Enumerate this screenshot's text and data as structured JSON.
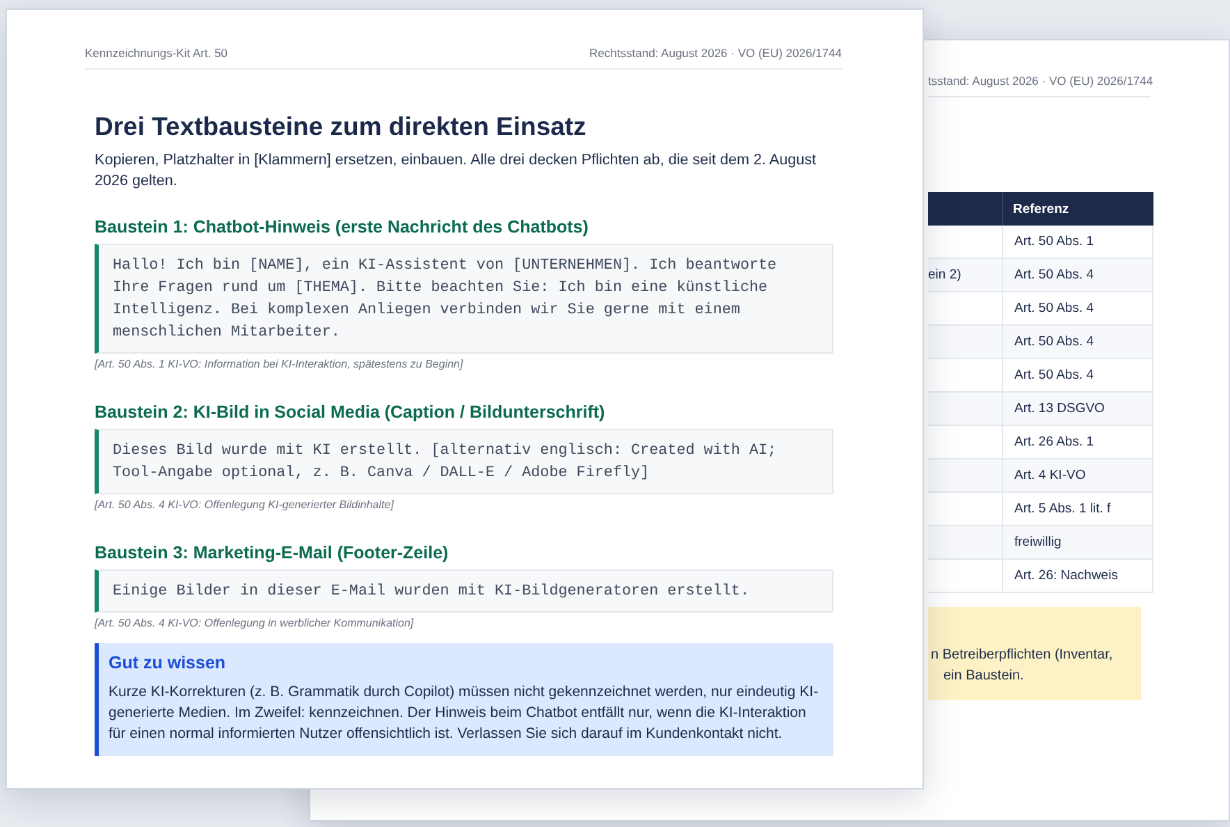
{
  "back_page": {
    "header_right": "tsstand: August 2026 · VO (EU) 2026/1744",
    "table": {
      "columns": [
        {
          "label": "Referenz"
        }
      ],
      "rows": [
        {
          "reference": "Art. 50 Abs. 1"
        },
        {
          "column_1": "ein 2)",
          "reference": "Art. 50 Abs. 4"
        },
        {
          "reference": "Art. 50 Abs. 4"
        },
        {
          "reference": "Art. 50 Abs. 4"
        },
        {
          "reference": "Art. 50 Abs. 4"
        },
        {
          "reference": "Art. 13 DSGVO"
        },
        {
          "reference": "Art. 26 Abs. 1"
        },
        {
          "reference": "Art. 4 KI-VO"
        },
        {
          "reference": "Art. 5 Abs. 1 lit. f"
        },
        {
          "reference": "freiwillig"
        },
        {
          "reference": "Art. 26: Nachweis"
        }
      ]
    },
    "note_lines": [
      "n Betreiberpflichten (Inventar,",
      "ein Baustein."
    ]
  },
  "front_page": {
    "header_left": "Kennzeichnungs-Kit Art. 50",
    "header_right": "Rechtsstand: August 2026 · VO (EU) 2026/1744",
    "title": "Drei Textbausteine zum direkten Einsatz",
    "intro": "Kopieren, Platzhalter in [Klammern] ersetzen, einbauen. Alle drei decken Pflichten ab, die seit dem 2. August 2026 gelten.",
    "blocks": [
      {
        "heading": "Baustein 1: Chatbot-Hinweis (erste Nachricht des Chatbots)",
        "text": "Hallo! Ich bin [NAME], ein KI-Assistent von [UNTERNEHMEN]. Ich beantworte Ihre Fragen rund um [THEMA]. Bitte beachten Sie: Ich bin eine künstliche Intelligenz. Bei komplexen Anliegen verbinden wir Sie gerne mit einem menschlichen Mitarbeiter.",
        "source": "[Art. 50 Abs. 1 KI-VO: Information bei KI-Interaktion, spätestens zu Beginn]"
      },
      {
        "heading": "Baustein 2: KI-Bild in Social Media (Caption / Bildunterschrift)",
        "text": "Dieses Bild wurde mit KI erstellt. [alternativ englisch: Created with AI; Tool-Angabe optional, z. B. Canva / DALL-E / Adobe Firefly]",
        "source": "[Art. 50 Abs. 4 KI-VO: Offenlegung KI-generierter Bildinhalte]"
      },
      {
        "heading": "Baustein 3: Marketing-E-Mail (Footer-Zeile)",
        "text": "Einige Bilder in dieser E-Mail wurden mit KI-Bildgeneratoren erstellt.",
        "source": "[Art. 50 Abs. 4 KI-VO: Offenlegung in werblicher Kommunikation]"
      }
    ],
    "info": {
      "title": "Gut zu wissen",
      "text": "Kurze KI-Korrekturen (z. B. Grammatik durch Copilot) müssen nicht gekennzeichnet werden, nur eindeutig KI-generierte Medien. Im Zweifel: kennzeichnen. Der Hinweis beim Chatbot entfällt nur, wenn die KI-Interaktion für einen normal informierten Nutzer offensichtlich ist. Verlassen Sie sich darauf im Kundenkontakt nicht."
    }
  }
}
